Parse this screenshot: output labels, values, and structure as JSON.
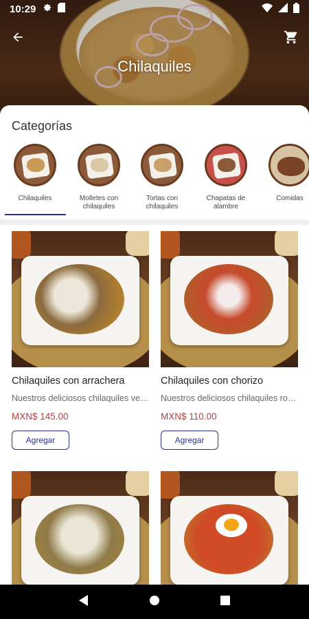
{
  "status_bar": {
    "time": "10:29"
  },
  "header": {
    "title": "Chilaquiles"
  },
  "categories": {
    "title": "Categorías",
    "items": [
      {
        "label": "Chilaquiles",
        "selected": true
      },
      {
        "label": "Molletes con chilaquiles"
      },
      {
        "label": "Tortas con chilaquiles"
      },
      {
        "label": "Chapatas de alambre"
      },
      {
        "label": "Comidas"
      }
    ]
  },
  "products": [
    {
      "name": "Chilaquiles con arrachera",
      "description": "Nuestros deliciosos chilaquiles verdes con arrachera",
      "price": "MXN$ 145.00",
      "button": "Agregar"
    },
    {
      "name": "Chilaquiles con chorizo",
      "description": "Nuestros deliciosos chilaquiles rojos con chorizo",
      "price": "MXN$ 110.00",
      "button": "Agregar"
    },
    {
      "name": "",
      "description": "",
      "price": "",
      "button": ""
    },
    {
      "name": "",
      "description": "",
      "price": "",
      "button": ""
    }
  ],
  "colors": {
    "accent": "#27318f",
    "price": "#b0413e"
  }
}
